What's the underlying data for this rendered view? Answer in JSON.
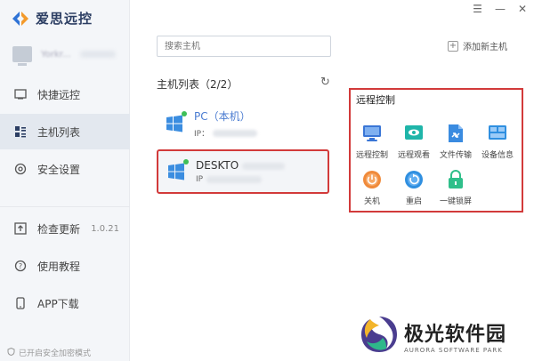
{
  "app": {
    "title": "爱思远控"
  },
  "window_controls": {
    "menu": "☰",
    "minimize": "—",
    "close": "✕"
  },
  "user": {
    "name": "Yorkr..."
  },
  "sidebar": {
    "items": [
      {
        "label": "快捷远控"
      },
      {
        "label": "主机列表"
      },
      {
        "label": "安全设置"
      },
      {
        "label": "检查更新",
        "version": "1.0.21"
      },
      {
        "label": "使用教程"
      },
      {
        "label": "APP下载"
      }
    ],
    "footer_note": "已开启安全加密模式"
  },
  "search": {
    "placeholder": "搜索主机"
  },
  "add_host": {
    "label": "添加新主机"
  },
  "host_list": {
    "title": "主机列表（2/2）",
    "hosts": [
      {
        "name": "PC（本机）",
        "ip_label": "IP："
      },
      {
        "name": "DESKTO",
        "ip_label": "IP"
      }
    ]
  },
  "remote_control": {
    "title": "远程控制",
    "items": [
      {
        "label": "远程控制",
        "icon": "monitor-icon",
        "color": "#3a76d6"
      },
      {
        "label": "远程观看",
        "icon": "eye-icon",
        "color": "#1fb5a9"
      },
      {
        "label": "文件传输",
        "icon": "file-transfer-icon",
        "color": "#3a8be0"
      },
      {
        "label": "设备信息",
        "icon": "device-info-icon",
        "color": "#2f8fe0"
      },
      {
        "label": "关机",
        "icon": "power-icon",
        "color": "#f08a3a"
      },
      {
        "label": "重启",
        "icon": "restart-icon",
        "color": "#2f8fe0"
      },
      {
        "label": "一键锁屏",
        "icon": "lock-icon",
        "color": "#2fbf8a"
      }
    ]
  },
  "watermark": {
    "cn": "极光软件园",
    "en": "AURORA SOFTWARE PARK"
  },
  "colors": {
    "accent": "#4a7bd1",
    "highlight_border": "#d23a3a",
    "online": "#3fbf58"
  }
}
